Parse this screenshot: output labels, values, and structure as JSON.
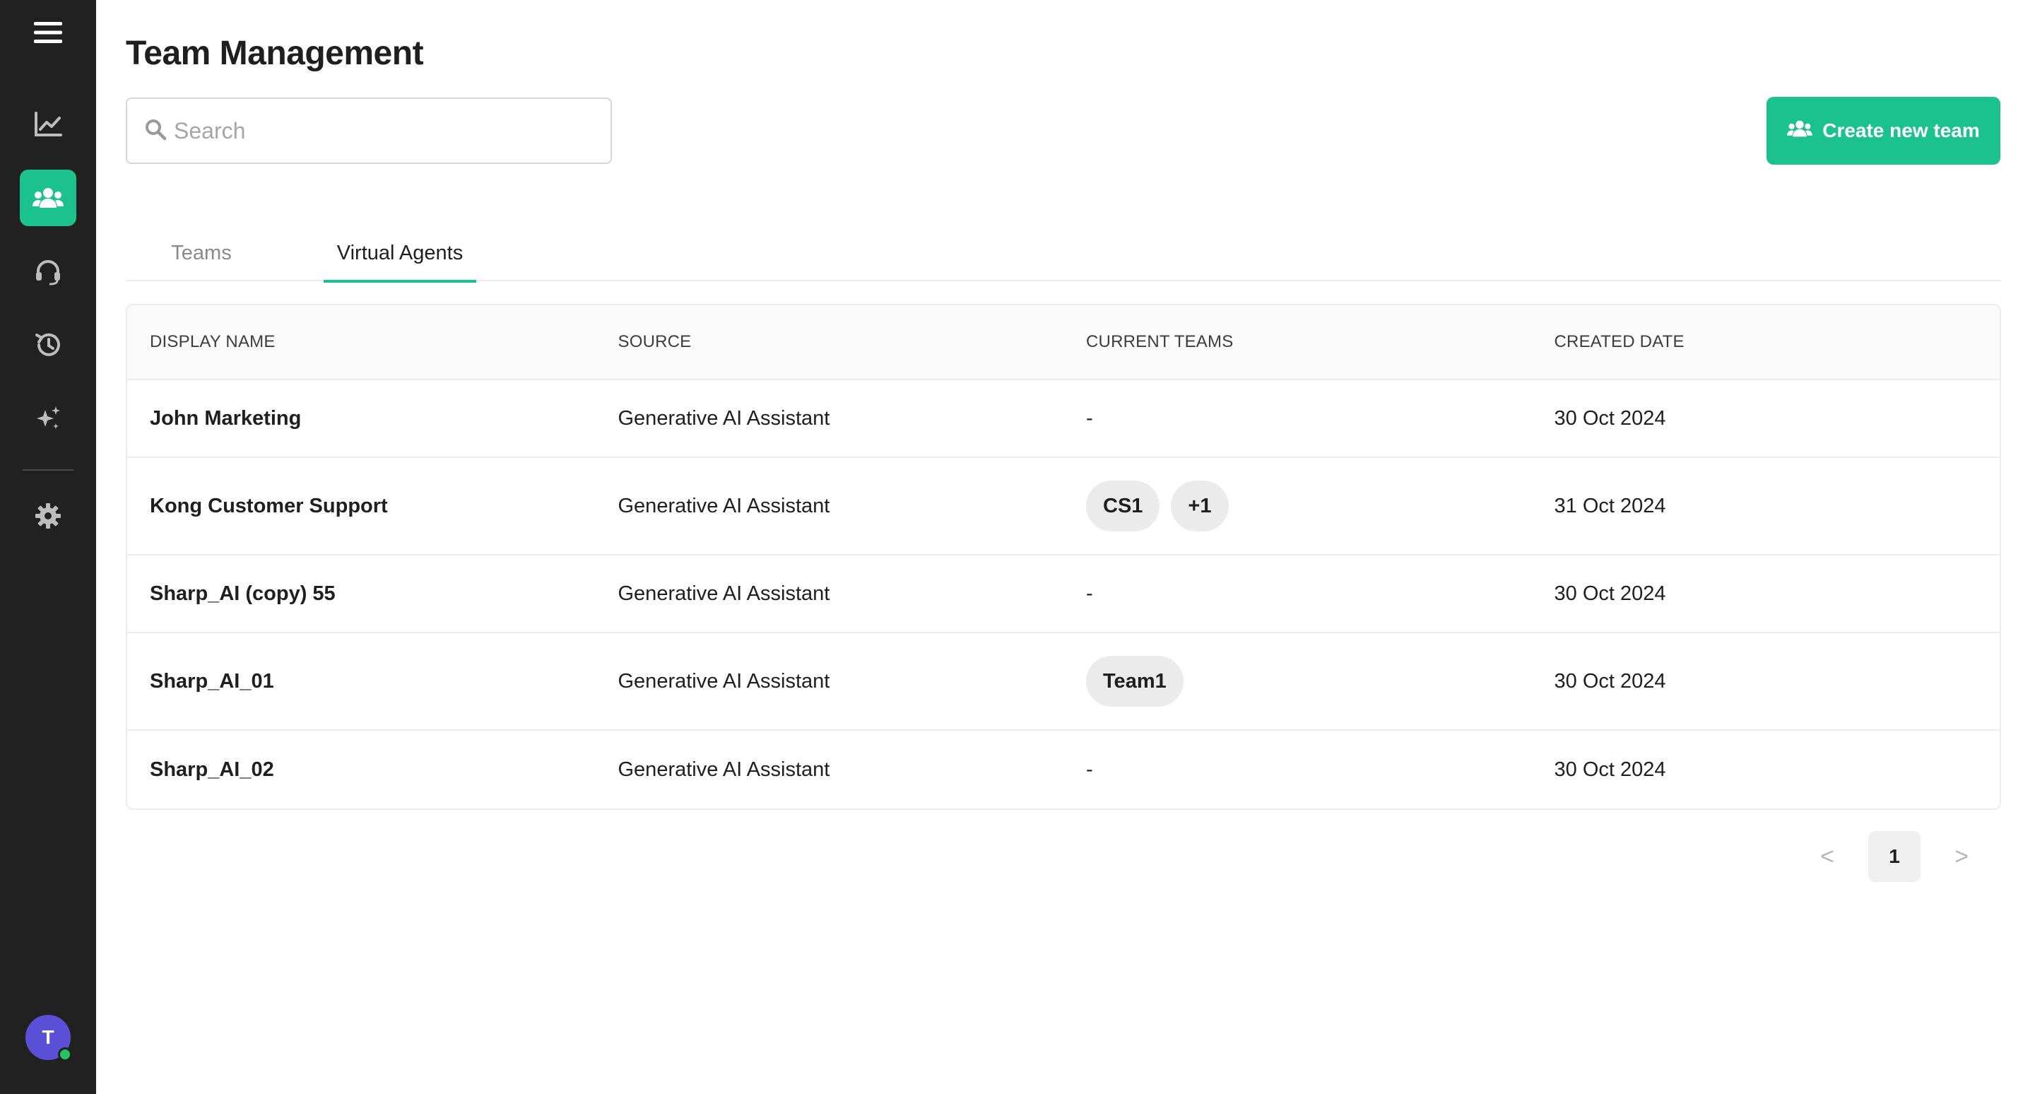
{
  "page": {
    "title": "Team Management"
  },
  "search": {
    "placeholder": "Search",
    "value": ""
  },
  "actions": {
    "create_label": "Create new team"
  },
  "tabs": [
    {
      "label": "Teams",
      "active": false
    },
    {
      "label": "Virtual Agents",
      "active": true
    }
  ],
  "table": {
    "columns": [
      "DISPLAY NAME",
      "SOURCE",
      "CURRENT TEAMS",
      "CREATED DATE"
    ],
    "rows": [
      {
        "name": "John Marketing",
        "source": "Generative AI Assistant",
        "teams": [
          "-"
        ],
        "created": "30 Oct 2024"
      },
      {
        "name": "Kong Customer Support",
        "source": "Generative AI Assistant",
        "teams": [
          "CS1",
          "+1"
        ],
        "created": "31 Oct 2024"
      },
      {
        "name": "Sharp_AI (copy) 55",
        "source": "Generative AI Assistant",
        "teams": [
          "-"
        ],
        "created": "30 Oct 2024"
      },
      {
        "name": "Sharp_AI_01",
        "source": "Generative AI Assistant",
        "teams": [
          "Team1"
        ],
        "created": "30 Oct 2024"
      },
      {
        "name": "Sharp_AI_02",
        "source": "Generative AI Assistant",
        "teams": [
          "-"
        ],
        "created": "30 Oct 2024"
      }
    ]
  },
  "pagination": {
    "current_page": "1",
    "prev": "<",
    "next": ">"
  },
  "sidebar": {
    "items": [
      {
        "name": "analytics",
        "icon": "chart-line-icon"
      },
      {
        "name": "teams",
        "icon": "users-icon",
        "active": true
      },
      {
        "name": "support",
        "icon": "headset-icon"
      },
      {
        "name": "history",
        "icon": "history-icon"
      },
      {
        "name": "ai",
        "icon": "sparkles-icon"
      },
      {
        "name": "settings",
        "icon": "gear-icon"
      }
    ],
    "avatar_initial": "T"
  },
  "colors": {
    "accent": "#1cc28d",
    "sidebar": "#212121",
    "avatar": "#5b4fd6",
    "presence": "#22c55e"
  }
}
